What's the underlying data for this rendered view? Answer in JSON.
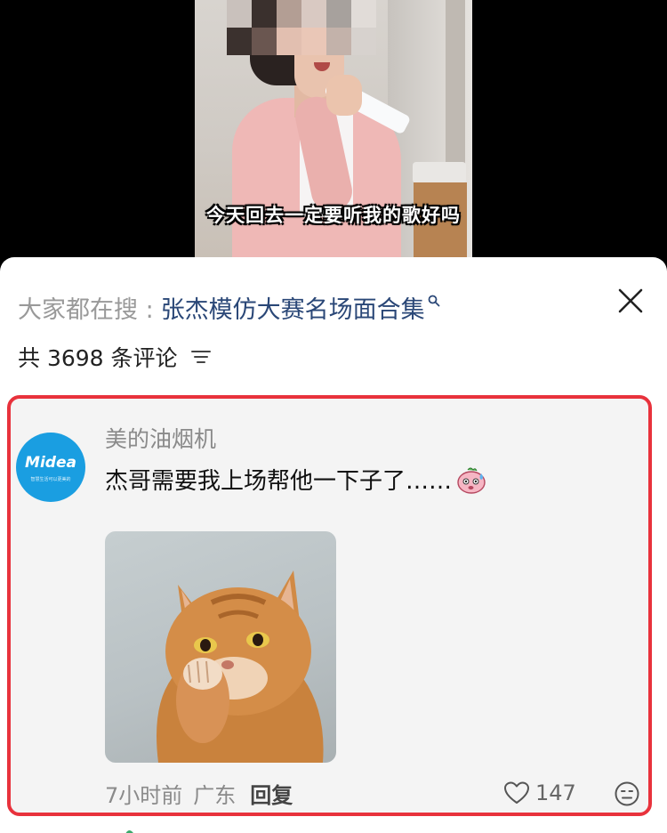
{
  "video": {
    "subtitle": "今天回去一定要听我的歌好吗"
  },
  "sheet": {
    "search_prefix": "大家都在搜 :",
    "search_query": "张杰模仿大赛名场面合集",
    "comment_count_text": "共 3698 条评论"
  },
  "comment": {
    "avatar_brand": "Midea",
    "avatar_slogan": "智慧生活可以更美的",
    "author": "美的油烟机",
    "text": "杰哥需要我上场帮他一下子了……",
    "time": "7小时前",
    "location": "广东",
    "reply_label": "回复",
    "like_count": "147"
  },
  "colors": {
    "highlight_border": "#e8323c",
    "search_query": "#2a4777",
    "avatar_bg": "#1a9ee1",
    "comment_bg": "#f4f4f4"
  },
  "icons": {
    "search": "search-icon",
    "close": "close-icon",
    "filter": "filter-icon",
    "emoji": "sweat-emoji-icon",
    "like": "heart-icon",
    "react": "emoji-face-icon"
  }
}
